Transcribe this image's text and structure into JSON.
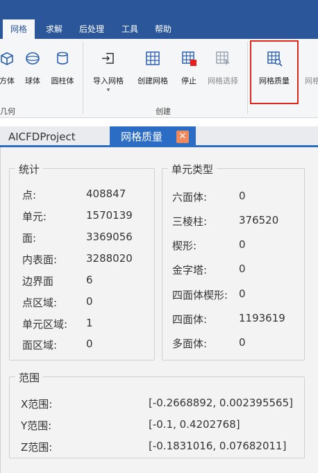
{
  "menu": {
    "tabs": [
      {
        "label": "网格"
      },
      {
        "label": "求解"
      },
      {
        "label": "后处理"
      },
      {
        "label": "工具"
      },
      {
        "label": "帮助"
      }
    ]
  },
  "ribbon": {
    "geometry_group": {
      "label": "几何",
      "buttons": [
        {
          "label": "方体"
        },
        {
          "label": "球体"
        },
        {
          "label": "圆柱体"
        }
      ]
    },
    "create_group": {
      "label": "创建",
      "buttons": [
        {
          "label": "导入网格"
        },
        {
          "label": "创建网格"
        },
        {
          "label": "停止"
        },
        {
          "label": "网格选择"
        }
      ]
    },
    "quality_group": {
      "buttons": [
        {
          "label": "网格质量"
        },
        {
          "label": "网格"
        }
      ]
    }
  },
  "tabs": {
    "project": "AICFDProject",
    "active": "网格质量",
    "close_glyph": "✕"
  },
  "stats": {
    "title": "统计",
    "rows": [
      {
        "label": "点:",
        "value": "408847"
      },
      {
        "label": "单元:",
        "value": "1570139"
      },
      {
        "label": "面:",
        "value": "3369056"
      },
      {
        "label": "内表面:",
        "value": "3288020"
      },
      {
        "label": "边界面",
        "value": "6"
      },
      {
        "label": "点区域:",
        "value": "0"
      },
      {
        "label": "单元区域:",
        "value": "1"
      },
      {
        "label": "面区域:",
        "value": "0"
      }
    ]
  },
  "cell_types": {
    "title": "单元类型",
    "rows": [
      {
        "label": "六面体:",
        "value": "0"
      },
      {
        "label": "三棱柱:",
        "value": "376520"
      },
      {
        "label": "楔形:",
        "value": "0"
      },
      {
        "label": "金字塔:",
        "value": "0"
      },
      {
        "label": "四面体楔形:",
        "value": "0"
      },
      {
        "label": "四面体:",
        "value": "1193619"
      },
      {
        "label": "多面体:",
        "value": "0"
      }
    ]
  },
  "range": {
    "title": "范围",
    "rows": [
      {
        "label": "X范围:",
        "value": "[-0.2668892, 0.002395565]"
      },
      {
        "label": "Y范围:",
        "value": "[-0.1, 0.4202768]"
      },
      {
        "label": "Z范围:",
        "value": "[-0.1831016, 0.07682011]"
      }
    ]
  },
  "colors": {
    "titlebar": "#2b579a",
    "tab_active": "#2b6cc4",
    "highlight": "#e3261c",
    "stop_red": "#e8201b",
    "icon_blue": "#2b5fb0"
  }
}
